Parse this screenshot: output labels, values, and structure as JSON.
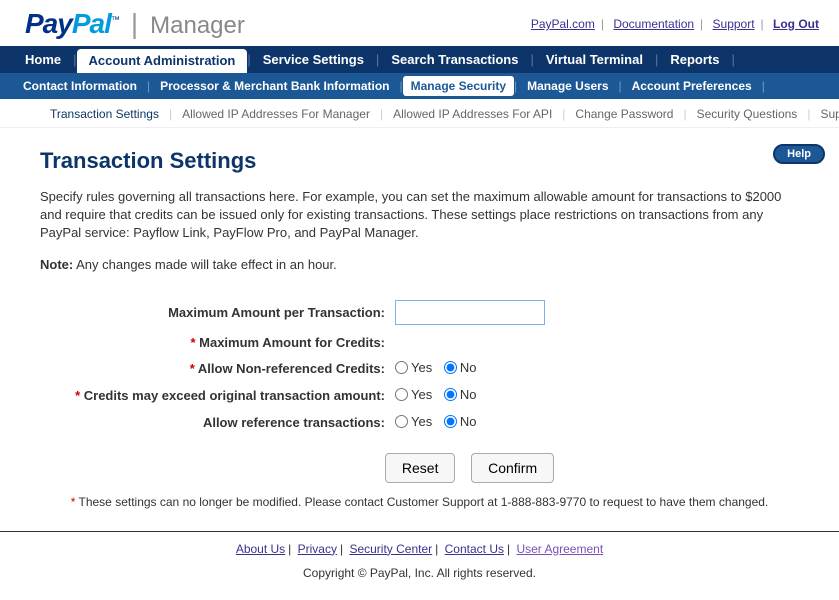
{
  "logo": {
    "pay": "Pay",
    "pal": "Pal",
    "tm": "™",
    "manager": "Manager"
  },
  "top_links": {
    "paypal": "PayPal.com",
    "docs": "Documentation",
    "support": "Support",
    "logout": "Log Out"
  },
  "nav1": {
    "home": "Home",
    "account_admin": "Account Administration",
    "service_settings": "Service Settings",
    "search": "Search Transactions",
    "virtual": "Virtual Terminal",
    "reports": "Reports"
  },
  "nav2": {
    "contact": "Contact Information",
    "processor": "Processor & Merchant Bank Information",
    "manage_security": "Manage Security",
    "manage_users": "Manage Users",
    "account_prefs": "Account Preferences"
  },
  "nav3": {
    "transaction": "Transaction Settings",
    "allowed_mgr": "Allowed IP Addresses For Manager",
    "allowed_api": "Allowed IP Addresses For API",
    "change_pw": "Change Password",
    "security_q": "Security Questions",
    "support": "Support"
  },
  "help": "Help",
  "page_title": "Transaction Settings",
  "desc": "Specify rules governing all transactions here. For example, you can set the maximum allowable amount for transactions to $2000 and require that credits can be issued only for existing transactions. These settings place restrictions on transactions from any PayPal service: Payflow Link, PayFlow Pro, and PayPal Manager.",
  "note_label": "Note:",
  "note_text": " Any changes made will take effect in an hour.",
  "form": {
    "max_per_tx": "Maximum Amount per Transaction:",
    "max_credits": "Maximum Amount for Credits:",
    "allow_nonref": "Allow Non-referenced Credits:",
    "credits_exceed": "Credits may exceed original transaction amount:",
    "allow_ref_tx": "Allow reference transactions:",
    "yes": "Yes",
    "no": "No"
  },
  "buttons": {
    "reset": "Reset",
    "confirm": "Confirm"
  },
  "footnote": " These settings can no longer be modified. Please contact Customer Support at 1-888-883-9770 to request to have them changed.",
  "footer": {
    "about": "About Us",
    "privacy": "Privacy",
    "security": "Security Center",
    "contact": "Contact Us",
    "agreement": "User Agreement",
    "copyright": "Copyright © PayPal, Inc. All rights reserved."
  }
}
